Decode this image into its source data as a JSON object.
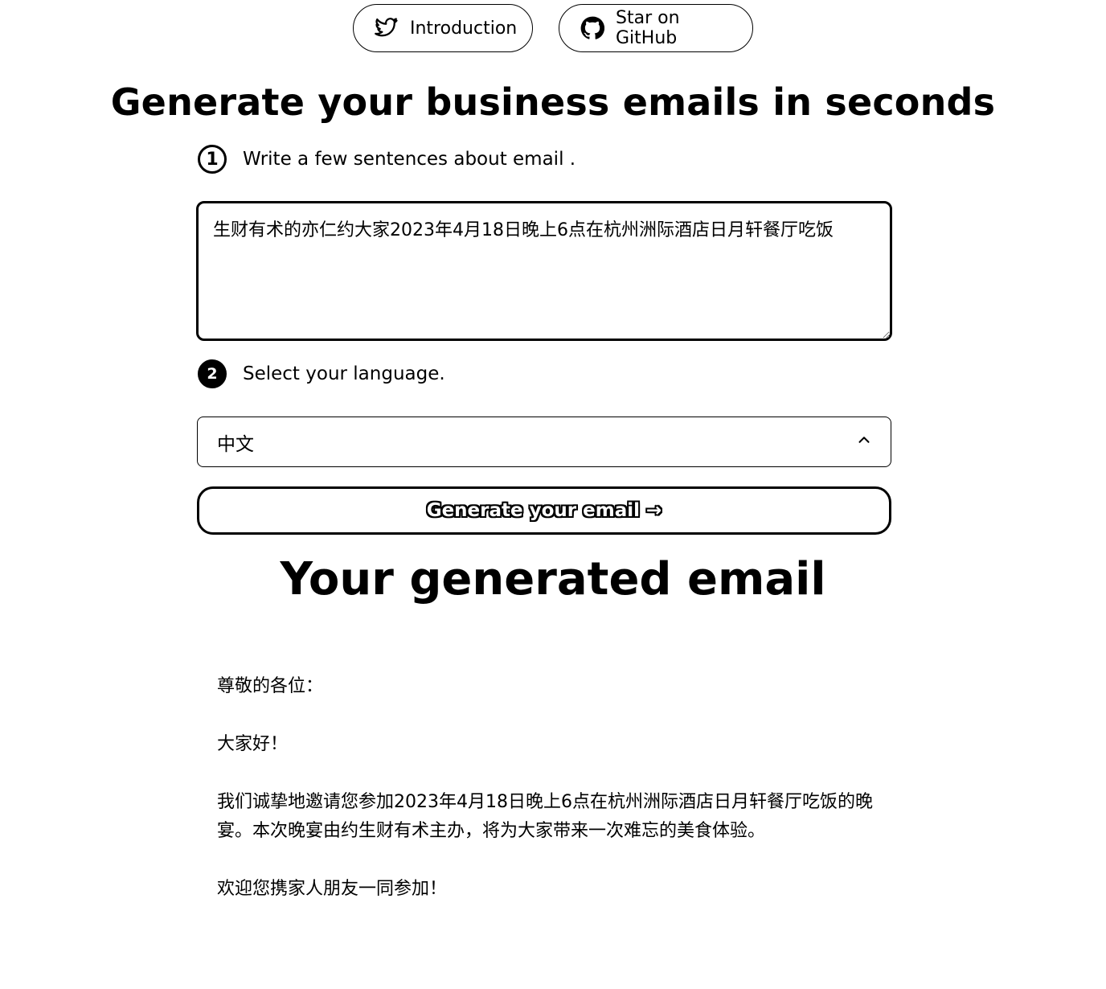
{
  "nav": {
    "introduction_label": "Introduction",
    "github_label": "Star on GitHub"
  },
  "icons": {
    "twitter": "twitter-icon",
    "github": "github-icon",
    "chevron": "chevron-up-icon"
  },
  "headline": "Generate your business emails in seconds",
  "step1": {
    "number": "1",
    "label": "Write a few sentences about email ."
  },
  "prompt": {
    "value": "生财有术的亦仁约大家2023年4月18日晚上6点在杭州洲际酒店日月轩餐厅吃饭"
  },
  "step2": {
    "number": "2",
    "label": "Select your language."
  },
  "language_select": {
    "selected": "中文"
  },
  "generate_button": {
    "label": "Generate your email →"
  },
  "result": {
    "title": "Your generated email",
    "paragraphs": [
      "尊敬的各位：",
      "大家好！",
      "我们诚挚地邀请您参加2023年4月18日晚上6点在杭州洲际酒店日月轩餐厅吃饭的晚宴。本次晚宴由约生财有术主办，将为大家带来一次难忘的美食体验。",
      "欢迎您携家人朋友一同参加！"
    ]
  }
}
